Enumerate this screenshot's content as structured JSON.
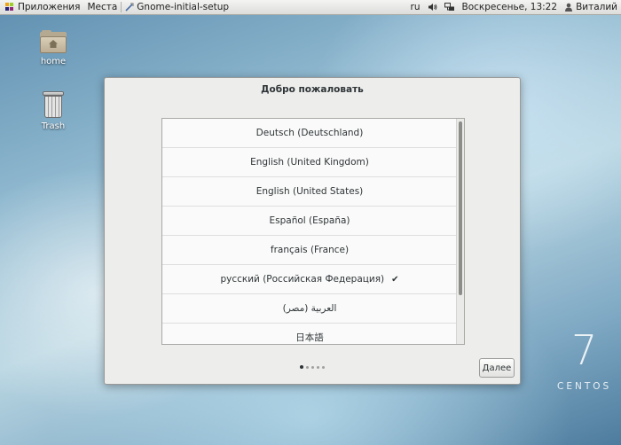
{
  "top_panel": {
    "applications": "Приложения",
    "places": "Места",
    "active_app": "Gnome-initial-setup",
    "keyboard_layout": "ru",
    "clock": "Воскресенье, 13:22",
    "user": "Виталий",
    "icons": [
      "logo-icon",
      "app-icon",
      "volume-icon",
      "network-icon",
      "user-icon"
    ]
  },
  "desktop": {
    "home_label": "home",
    "trash_label": "Trash"
  },
  "dialog": {
    "title": "Добро пожаловать",
    "languages": [
      {
        "label": "Deutsch (Deutschland)",
        "selected": false
      },
      {
        "label": "English (United Kingdom)",
        "selected": false
      },
      {
        "label": "English (United States)",
        "selected": false
      },
      {
        "label": "Español (España)",
        "selected": false
      },
      {
        "label": "français (France)",
        "selected": false
      },
      {
        "label": "русский (Российская Федерация)",
        "selected": true
      },
      {
        "label": "العربية (مصر)",
        "selected": false
      },
      {
        "label": "日本語",
        "selected": false
      }
    ],
    "check_mark": "✔",
    "page_indicator": {
      "total": 5,
      "current": 1
    },
    "next_label": "Далее"
  },
  "brand": {
    "numeral": "7",
    "name": "CENTOS"
  },
  "colors": {
    "panel_bg": "#dcdcda",
    "dialog_bg": "#ededec",
    "list_bg": "#fafafa",
    "text": "#2e3436"
  }
}
